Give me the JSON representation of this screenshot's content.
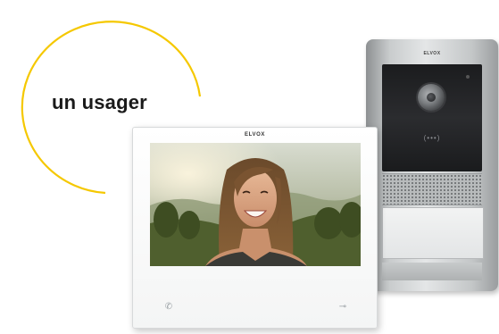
{
  "headline": "un usager",
  "colors": {
    "accent_arc": "#f5c800",
    "headline_text": "#1a1a1a"
  },
  "door_station": {
    "brand_text": "ELVOX",
    "rfid_symbol": "(•••)"
  },
  "monitor": {
    "brand_text": "ELVOX",
    "left_key_icon": "handset-icon",
    "right_key_icon": "door-key-icon"
  }
}
